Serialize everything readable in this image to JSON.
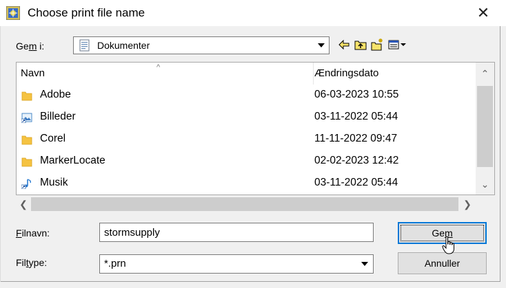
{
  "window": {
    "title": "Choose print file name",
    "close_glyph": "✕"
  },
  "lookin": {
    "label_prefix": "Ge",
    "label_accel": "m",
    "label_suffix": " i:",
    "value": "Dokumenter",
    "icon": "documents-folder-icon"
  },
  "toolbar": {
    "icons": [
      "back-arrow-icon",
      "up-folder-icon",
      "new-folder-icon",
      "view-menu-icon"
    ]
  },
  "list": {
    "columns": [
      "Navn",
      "Ændringsdato"
    ],
    "rows": [
      {
        "name": "Adobe",
        "date": "06-03-2023 10:55",
        "icon": "folder-icon"
      },
      {
        "name": "Billeder",
        "date": "03-11-2022 05:44",
        "icon": "pictures-shortcut-icon"
      },
      {
        "name": "Corel",
        "date": "11-11-2022 09:47",
        "icon": "folder-icon"
      },
      {
        "name": "MarkerLocate",
        "date": "02-02-2023 12:42",
        "icon": "folder-icon"
      },
      {
        "name": "Musik",
        "date": "03-11-2022 05:44",
        "icon": "music-shortcut-icon"
      }
    ]
  },
  "filename": {
    "label_accel": "F",
    "label_rest": "ilnavn:",
    "value": "stormsupply"
  },
  "filetype": {
    "label_prefix": "Fil",
    "label_accel": "t",
    "label_suffix": "ype:",
    "value": "*.prn"
  },
  "buttons": {
    "save_prefix": "Ge",
    "save_accel": "m",
    "cancel": "Annuller"
  },
  "colors": {
    "accent": "#0078d7",
    "folder": "#f5c342"
  }
}
